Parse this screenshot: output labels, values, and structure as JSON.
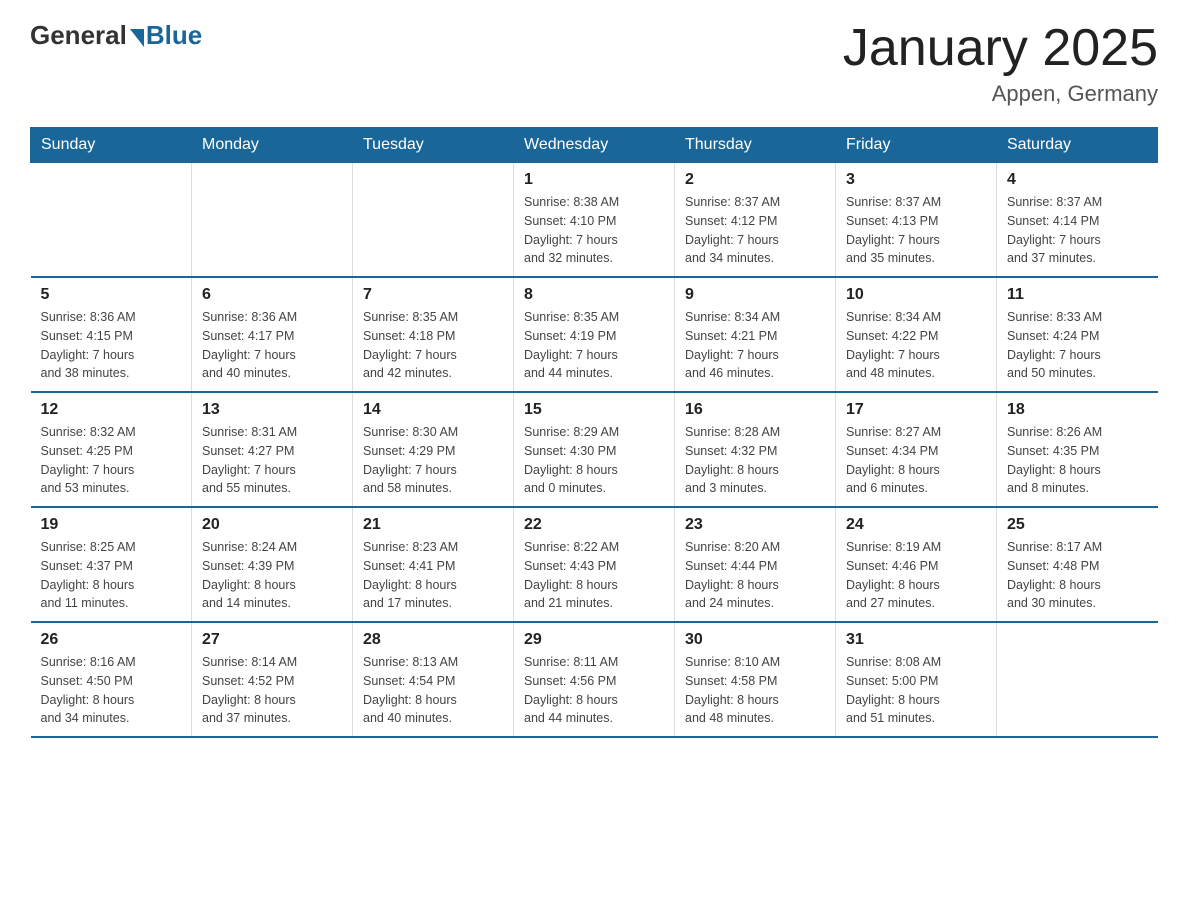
{
  "logo": {
    "general": "General",
    "blue": "Blue"
  },
  "title": "January 2025",
  "subtitle": "Appen, Germany",
  "days_of_week": [
    "Sunday",
    "Monday",
    "Tuesday",
    "Wednesday",
    "Thursday",
    "Friday",
    "Saturday"
  ],
  "weeks": [
    [
      {
        "day": "",
        "info": ""
      },
      {
        "day": "",
        "info": ""
      },
      {
        "day": "",
        "info": ""
      },
      {
        "day": "1",
        "info": "Sunrise: 8:38 AM\nSunset: 4:10 PM\nDaylight: 7 hours\nand 32 minutes."
      },
      {
        "day": "2",
        "info": "Sunrise: 8:37 AM\nSunset: 4:12 PM\nDaylight: 7 hours\nand 34 minutes."
      },
      {
        "day": "3",
        "info": "Sunrise: 8:37 AM\nSunset: 4:13 PM\nDaylight: 7 hours\nand 35 minutes."
      },
      {
        "day": "4",
        "info": "Sunrise: 8:37 AM\nSunset: 4:14 PM\nDaylight: 7 hours\nand 37 minutes."
      }
    ],
    [
      {
        "day": "5",
        "info": "Sunrise: 8:36 AM\nSunset: 4:15 PM\nDaylight: 7 hours\nand 38 minutes."
      },
      {
        "day": "6",
        "info": "Sunrise: 8:36 AM\nSunset: 4:17 PM\nDaylight: 7 hours\nand 40 minutes."
      },
      {
        "day": "7",
        "info": "Sunrise: 8:35 AM\nSunset: 4:18 PM\nDaylight: 7 hours\nand 42 minutes."
      },
      {
        "day": "8",
        "info": "Sunrise: 8:35 AM\nSunset: 4:19 PM\nDaylight: 7 hours\nand 44 minutes."
      },
      {
        "day": "9",
        "info": "Sunrise: 8:34 AM\nSunset: 4:21 PM\nDaylight: 7 hours\nand 46 minutes."
      },
      {
        "day": "10",
        "info": "Sunrise: 8:34 AM\nSunset: 4:22 PM\nDaylight: 7 hours\nand 48 minutes."
      },
      {
        "day": "11",
        "info": "Sunrise: 8:33 AM\nSunset: 4:24 PM\nDaylight: 7 hours\nand 50 minutes."
      }
    ],
    [
      {
        "day": "12",
        "info": "Sunrise: 8:32 AM\nSunset: 4:25 PM\nDaylight: 7 hours\nand 53 minutes."
      },
      {
        "day": "13",
        "info": "Sunrise: 8:31 AM\nSunset: 4:27 PM\nDaylight: 7 hours\nand 55 minutes."
      },
      {
        "day": "14",
        "info": "Sunrise: 8:30 AM\nSunset: 4:29 PM\nDaylight: 7 hours\nand 58 minutes."
      },
      {
        "day": "15",
        "info": "Sunrise: 8:29 AM\nSunset: 4:30 PM\nDaylight: 8 hours\nand 0 minutes."
      },
      {
        "day": "16",
        "info": "Sunrise: 8:28 AM\nSunset: 4:32 PM\nDaylight: 8 hours\nand 3 minutes."
      },
      {
        "day": "17",
        "info": "Sunrise: 8:27 AM\nSunset: 4:34 PM\nDaylight: 8 hours\nand 6 minutes."
      },
      {
        "day": "18",
        "info": "Sunrise: 8:26 AM\nSunset: 4:35 PM\nDaylight: 8 hours\nand 8 minutes."
      }
    ],
    [
      {
        "day": "19",
        "info": "Sunrise: 8:25 AM\nSunset: 4:37 PM\nDaylight: 8 hours\nand 11 minutes."
      },
      {
        "day": "20",
        "info": "Sunrise: 8:24 AM\nSunset: 4:39 PM\nDaylight: 8 hours\nand 14 minutes."
      },
      {
        "day": "21",
        "info": "Sunrise: 8:23 AM\nSunset: 4:41 PM\nDaylight: 8 hours\nand 17 minutes."
      },
      {
        "day": "22",
        "info": "Sunrise: 8:22 AM\nSunset: 4:43 PM\nDaylight: 8 hours\nand 21 minutes."
      },
      {
        "day": "23",
        "info": "Sunrise: 8:20 AM\nSunset: 4:44 PM\nDaylight: 8 hours\nand 24 minutes."
      },
      {
        "day": "24",
        "info": "Sunrise: 8:19 AM\nSunset: 4:46 PM\nDaylight: 8 hours\nand 27 minutes."
      },
      {
        "day": "25",
        "info": "Sunrise: 8:17 AM\nSunset: 4:48 PM\nDaylight: 8 hours\nand 30 minutes."
      }
    ],
    [
      {
        "day": "26",
        "info": "Sunrise: 8:16 AM\nSunset: 4:50 PM\nDaylight: 8 hours\nand 34 minutes."
      },
      {
        "day": "27",
        "info": "Sunrise: 8:14 AM\nSunset: 4:52 PM\nDaylight: 8 hours\nand 37 minutes."
      },
      {
        "day": "28",
        "info": "Sunrise: 8:13 AM\nSunset: 4:54 PM\nDaylight: 8 hours\nand 40 minutes."
      },
      {
        "day": "29",
        "info": "Sunrise: 8:11 AM\nSunset: 4:56 PM\nDaylight: 8 hours\nand 44 minutes."
      },
      {
        "day": "30",
        "info": "Sunrise: 8:10 AM\nSunset: 4:58 PM\nDaylight: 8 hours\nand 48 minutes."
      },
      {
        "day": "31",
        "info": "Sunrise: 8:08 AM\nSunset: 5:00 PM\nDaylight: 8 hours\nand 51 minutes."
      },
      {
        "day": "",
        "info": ""
      }
    ]
  ]
}
